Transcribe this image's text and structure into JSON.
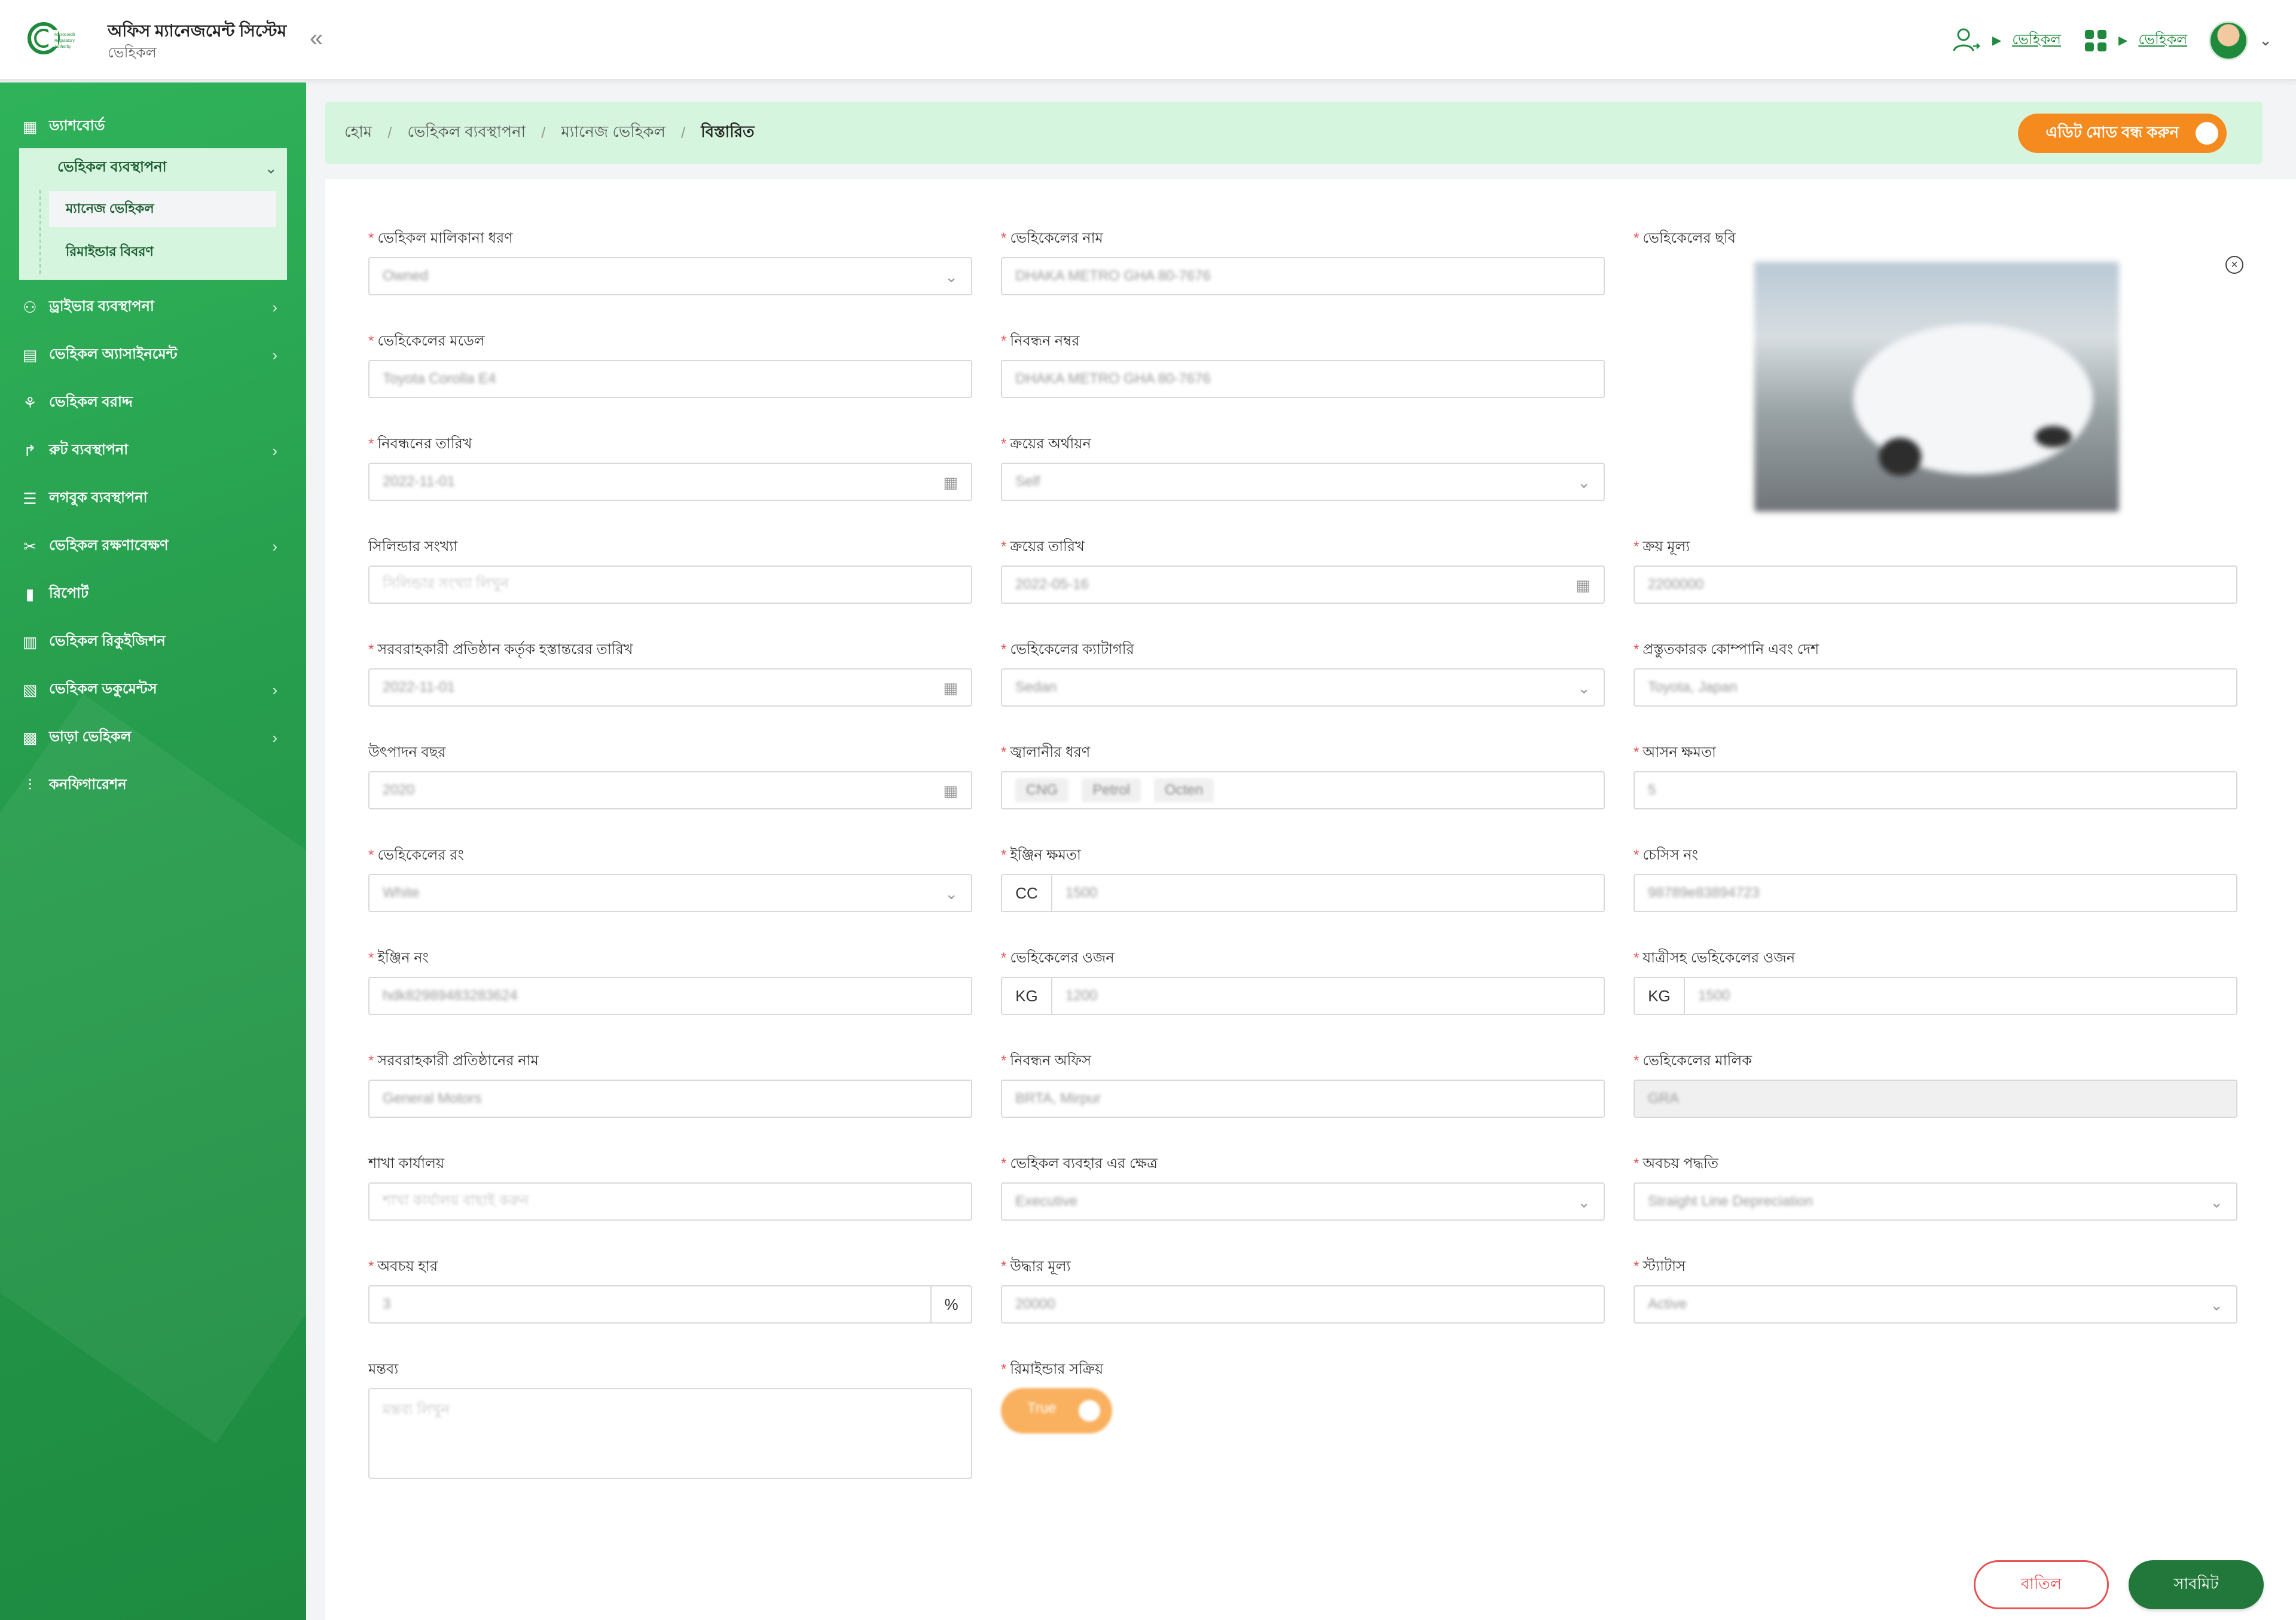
{
  "header": {
    "title": "অফিস ম্যানেজমেন্ট সিস্টেম",
    "subtitle": "ভেহিকল",
    "collapse_glyph": "«",
    "link1": "ভেহিকল",
    "link2": "ভেহিকল"
  },
  "sidebar": {
    "items": [
      {
        "label": "ড্যাশবোর্ড"
      },
      {
        "label": "ভেহিকল ব্যবস্থাপনা"
      },
      {
        "label": "ড্রাইভার ব্যবস্থাপনা"
      },
      {
        "label": "ভেহিকল অ্যাসাইনমেন্ট"
      },
      {
        "label": "ভেহিকল বরাদ্দ"
      },
      {
        "label": "রুট ব্যবস্থাপনা"
      },
      {
        "label": "লগবুক ব্যবস্থাপনা"
      },
      {
        "label": "ভেহিকল রক্ষণাবেক্ষণ"
      },
      {
        "label": "রিপোর্ট"
      },
      {
        "label": "ভেহিকল রিকুইজিশন"
      },
      {
        "label": "ভেহিকল ডকুমেন্টস"
      },
      {
        "label": "ভাড়া ভেহিকল"
      },
      {
        "label": "কনফিগারেশন"
      }
    ],
    "subitems": [
      {
        "label": "ম্যানেজ ভেহিকল"
      },
      {
        "label": "রিমাইন্ডার বিবরণ"
      }
    ]
  },
  "breadcrumb": {
    "home": "হোম",
    "level1": "ভেহিকল ব্যবস্থাপনা",
    "level2": "ম্যানেজ ভেহিকল",
    "current": "বিস্তারিত"
  },
  "edit_mode_label": "এডিট মোড বন্ধ করুন",
  "form": {
    "ownership_type": {
      "label": "ভেহিকল মালিকানা ধরণ",
      "value": "Owned"
    },
    "vehicle_name": {
      "label": "ভেহিকেলের নাম",
      "value": "DHAKA METRO GHA 80-7676"
    },
    "vehicle_photo": {
      "label": "ভেহিকেলের ছবি"
    },
    "model": {
      "label": "ভেহিকেলের মডেল",
      "value": "Toyota Corolla E4"
    },
    "registration_no": {
      "label": "নিবন্ধন নম্বর",
      "value": "DHAKA METRO GHA 80-7676"
    },
    "registration_date": {
      "label": "নিবন্ধনের তারিখ",
      "value": "2022-11-01"
    },
    "purchase_funding": {
      "label": "ক্রয়ের অর্থায়ন",
      "value": "Self"
    },
    "cylinder_count": {
      "label": "সিলিন্ডার সংখ্যা",
      "placeholder": "সিলিন্ডার সংখ্যা লিখুন"
    },
    "purchase_date": {
      "label": "ক্রয়ের তারিখ",
      "value": "2022-05-16"
    },
    "purchase_price": {
      "label": "ক্রয় মূল্য",
      "value": "2200000"
    },
    "handover_date": {
      "label": "সরবরাহকারী প্রতিষ্ঠান কর্তৃক হস্তান্তরের তারিখ",
      "value": "2022-11-01"
    },
    "category": {
      "label": "ভেহিকেলের ক্যাটাগরি",
      "value": "Sedan"
    },
    "manufacturer": {
      "label": "প্রস্তুতকারক কোম্পানি এবং দেশ",
      "value": "Toyota, Japan"
    },
    "production_year": {
      "label": "উৎপাদন বছর",
      "value": "2020"
    },
    "fuel_type": {
      "label": "জ্বালানীর ধরণ",
      "tags": [
        "CNG",
        "Petrol",
        "Octen"
      ]
    },
    "seat_capacity": {
      "label": "আসন ক্ষমতা",
      "value": "5"
    },
    "color": {
      "label": "ভেহিকেলের রং",
      "value": "White"
    },
    "engine_capacity": {
      "label": "ইঞ্জিন ক্ষমতা",
      "unit": "CC",
      "value": "1500"
    },
    "chassis_no": {
      "label": "চেসিস নং",
      "value": "98789e83894723"
    },
    "engine_no": {
      "label": "ইঞ্জিন নং",
      "value": "hdk82989483283624"
    },
    "vehicle_weight": {
      "label": "ভেহিকেলের ওজন",
      "unit": "KG",
      "value": "1200"
    },
    "loaded_weight": {
      "label": "যাত্রীসহ ভেহিকেলের ওজন",
      "unit": "KG",
      "value": "1500"
    },
    "supplier_name": {
      "label": "সরবরাহকারী প্রতিষ্ঠানের নাম",
      "value": "General Motors"
    },
    "registration_office": {
      "label": "নিবন্ধন অফিস",
      "value": "BRTA, Mirpur"
    },
    "owner": {
      "label": "ভেহিকেলের মালিক",
      "value": "GRA"
    },
    "branch_office": {
      "label": "শাখা কার্যালয়",
      "placeholder": "শাখা কার্যালয় বাছাই করুন"
    },
    "usage_area": {
      "label": "ভেহিকল ব্যবহার এর ক্ষেত্র",
      "value": "Executive"
    },
    "depreciation_method": {
      "label": "অবচয় পদ্ধতি",
      "value": "Straight Line Depreciation"
    },
    "depreciation_rate": {
      "label": "অবচয় হার",
      "value": "3",
      "unit": "%"
    },
    "salvage_value": {
      "label": "উদ্ধার মূল্য",
      "value": "20000"
    },
    "status": {
      "label": "স্ট্যাটাস",
      "value": "Active"
    },
    "remarks": {
      "label": "মন্তব্য",
      "placeholder": "মন্তব্য লিখুন"
    },
    "reminder_active": {
      "label": "রিমাইন্ডার সক্রিয়",
      "value": "True"
    }
  },
  "buttons": {
    "cancel": "বাতিল",
    "submit": "সাবমিট"
  },
  "colors": {
    "primary": "#21783a",
    "sidebar": "#279e4d",
    "accent": "#f58b1f",
    "required": "#e55353"
  }
}
